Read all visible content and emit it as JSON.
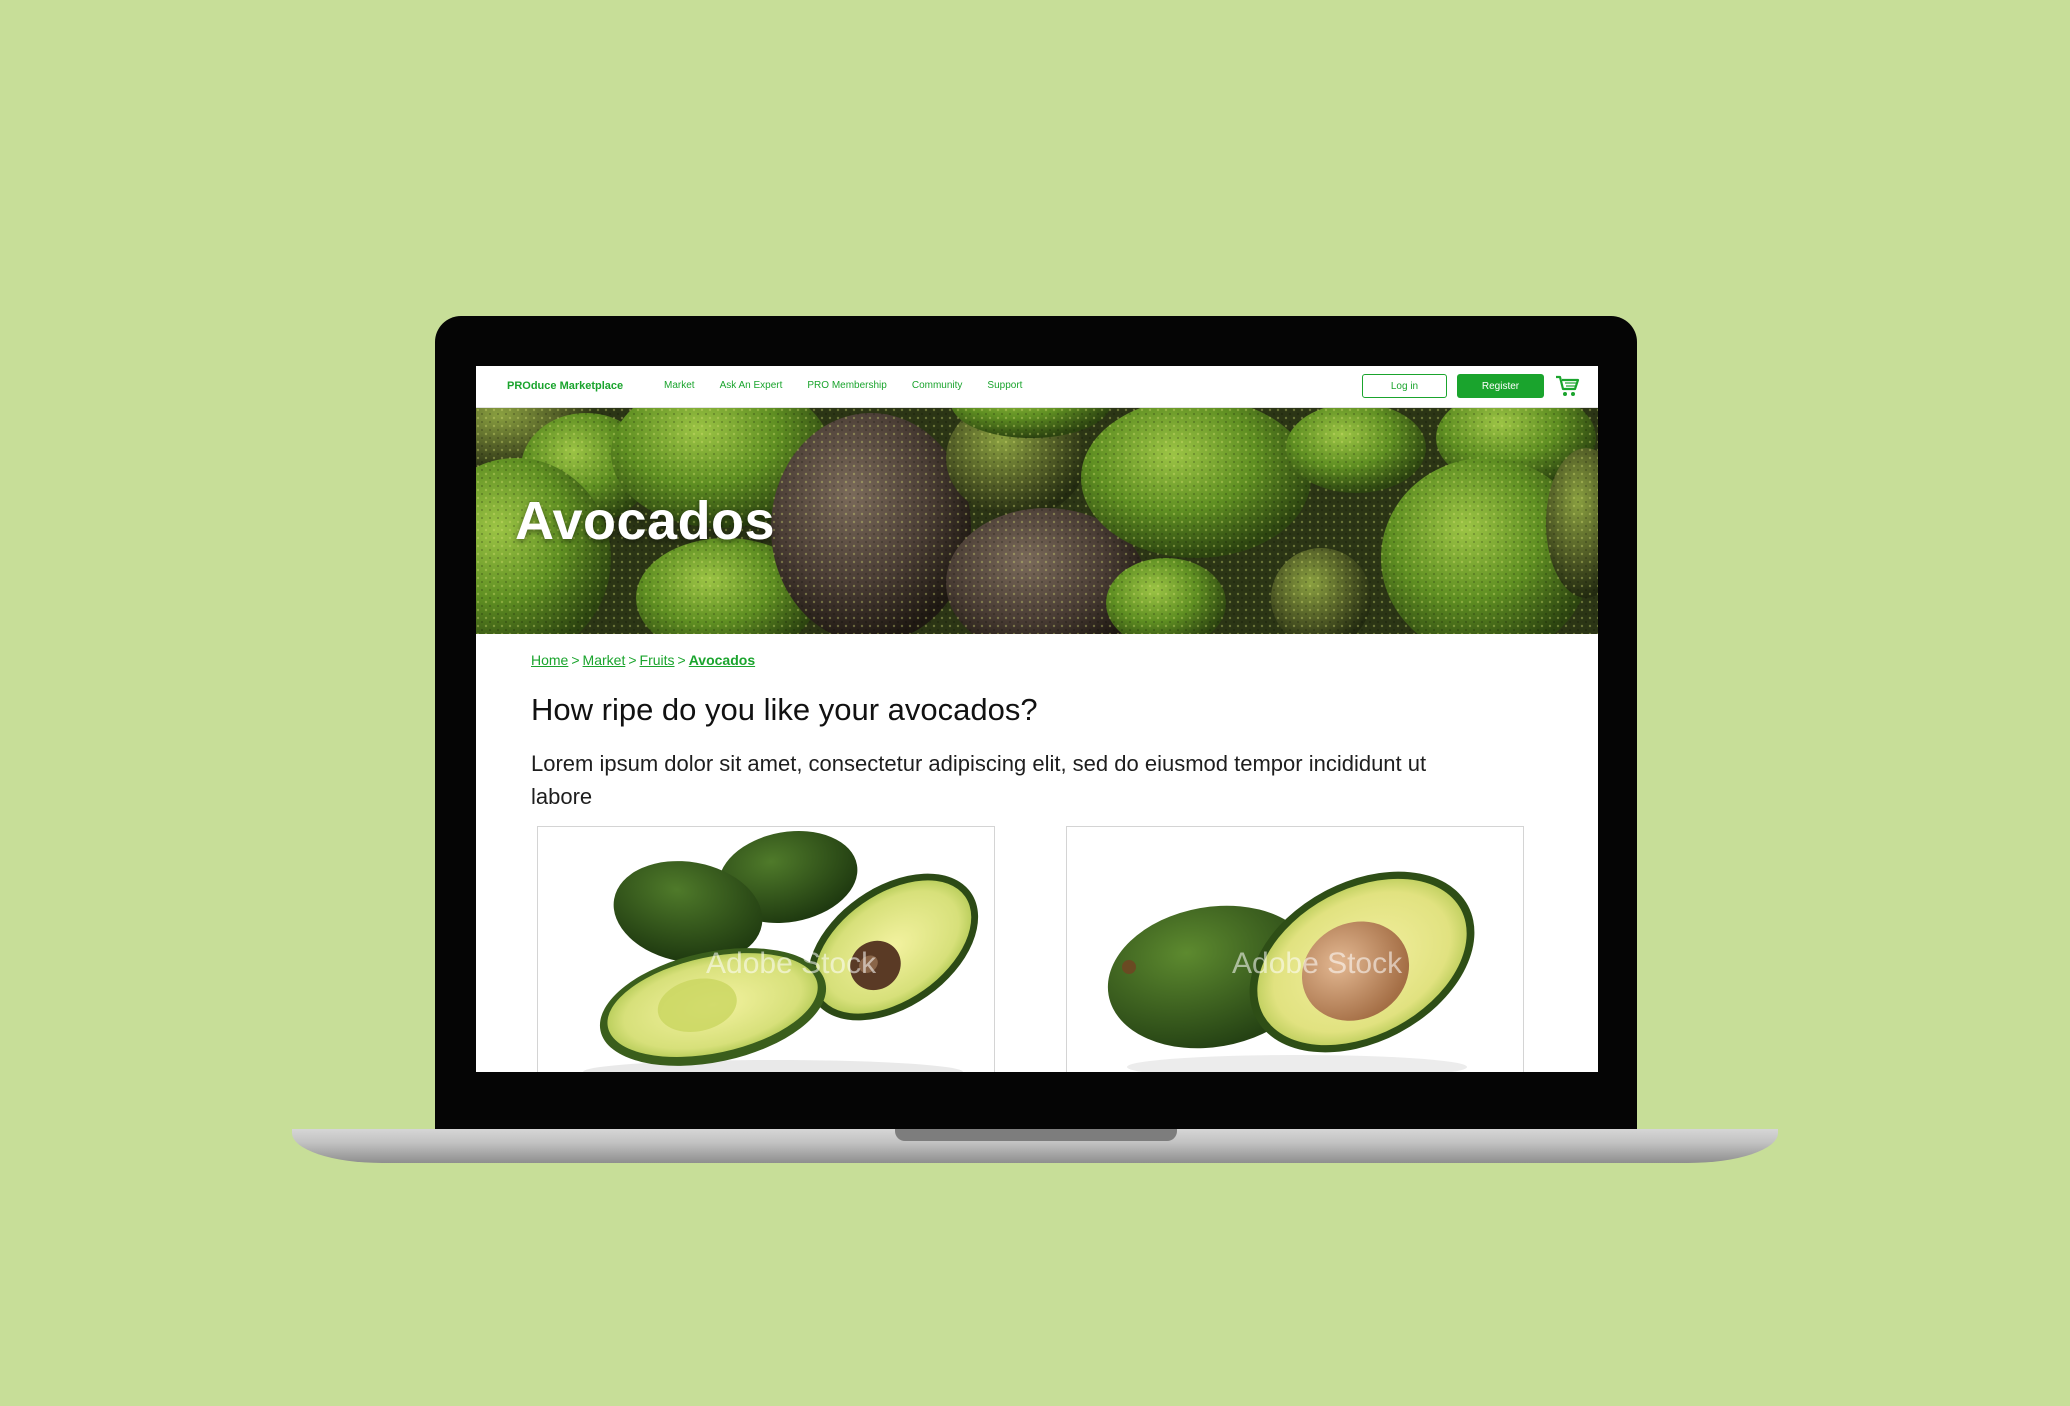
{
  "nav": {
    "brand": "PROduce Marketplace",
    "links": [
      "Market",
      "Ask An Expert",
      "PRO Membership",
      "Community",
      "Support"
    ],
    "login_label": "Log in",
    "register_label": "Register",
    "cart_icon": "shopping-cart-icon"
  },
  "hero": {
    "title": "Avocados"
  },
  "breadcrumb": {
    "items": [
      "Home",
      "Market",
      "Fruits",
      "Avocados"
    ],
    "separator": ">"
  },
  "content": {
    "question": "How ripe do you like your avocados?",
    "body": "Lorem ipsum dolor sit amet, consectetur adipiscing elit, sed do eiusmod tempor incididunt ut labore"
  },
  "cards": [
    {
      "watermark": "Adobe Stock"
    },
    {
      "watermark": "Adobe Stock"
    }
  ],
  "colors": {
    "background": "#c7de98",
    "accent": "#1aa42d"
  }
}
